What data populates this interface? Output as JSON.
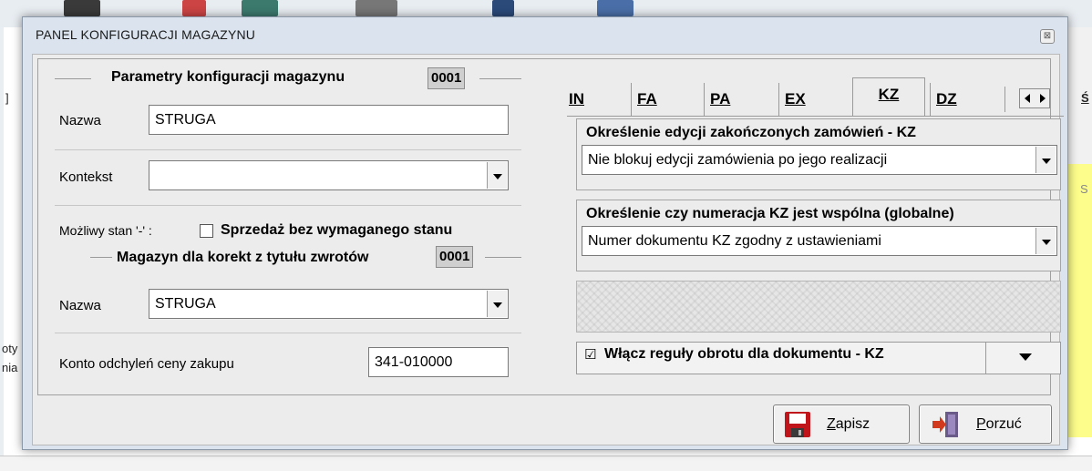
{
  "background": {
    "left_texts": [
      "]",
      "oty",
      "nia"
    ],
    "right_text": "Ś",
    "right_small": "S"
  },
  "dialog": {
    "title": "PANEL KONFIGURACJI MAGAZYNU",
    "close_glyph": "⊠"
  },
  "left": {
    "params_title": "Parametry konfiguracji  magazynu",
    "params_code": "0001",
    "nazwa_label": "Nazwa",
    "nazwa_value": "STRUGA",
    "kontekst_label": "Kontekst",
    "kontekst_value": "",
    "mozliwy_label": "Możliwy stan '-' :",
    "sprzedaz_label": "Sprzedaż bez wymaganego stanu",
    "sprzedaz_checked": false,
    "korekty_title": "Magazyn dla korekt z tytułu zwrotów",
    "korekty_code": "0001",
    "nazwa2_label": "Nazwa",
    "nazwa2_value": "STRUGA",
    "konto_label": "Konto odchyleń  ceny  zakupu",
    "konto_value": "341-010000"
  },
  "tabs": {
    "items": [
      {
        "label": "IN"
      },
      {
        "label": "FA"
      },
      {
        "label": "PA"
      },
      {
        "label": "EX"
      },
      {
        "label": "KZ"
      },
      {
        "label": "DZ"
      }
    ],
    "active": "KZ"
  },
  "kz": {
    "group1_title": "Określenie edycji zakończonych zamówień  - KZ",
    "group1_value": "Nie blokuj edycji zamówienia po jego realizacji",
    "group2_title": "Określenie czy numeracja KZ jest wspólna (globalne)",
    "group2_value": "Numer dokumentu KZ zgodny z ustawieniami",
    "rules_checked_glyph": "☑",
    "rules_label": "Włącz reguły obrotu dla dokumentu - KZ"
  },
  "footer": {
    "save_underlined": "Z",
    "save_rest": "apisz",
    "cancel_underlined": "P",
    "cancel_rest": "orzuć"
  },
  "colors": {
    "dialog_frame": "#dbe4ee",
    "client_bg": "#ececec",
    "save_icon": "#c0151b",
    "cancel_icon": "#d23a1e"
  }
}
